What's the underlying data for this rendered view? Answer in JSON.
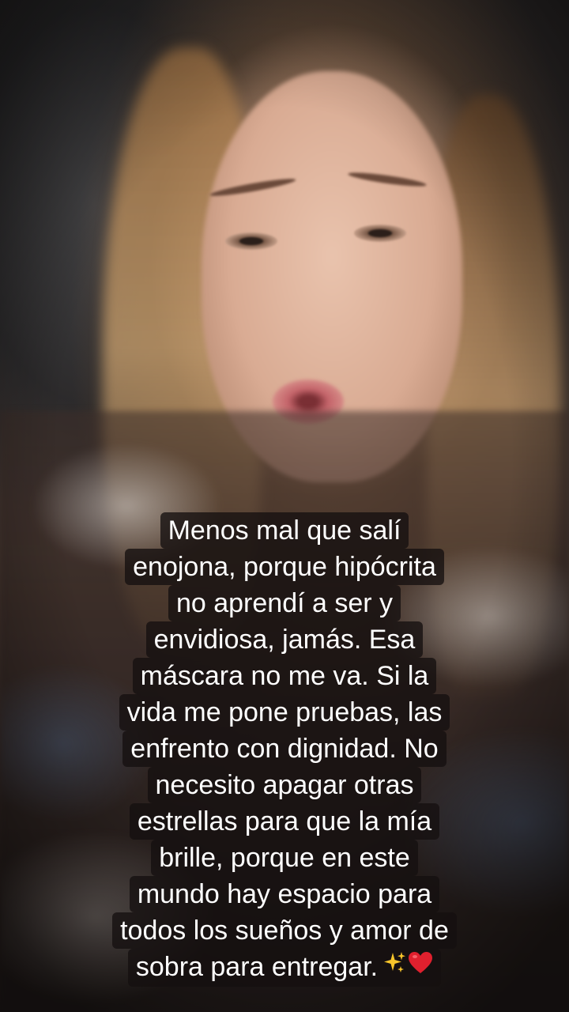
{
  "caption": {
    "lines": [
      "Menos mal que salí",
      "enojona, porque hipócrita",
      "no aprendí a ser y",
      "envidiosa, jamás. Esa",
      "máscara no me va. Si la",
      "vida me pone pruebas, las",
      "enfrento con dignidad. No",
      "necesito apagar otras",
      "estrellas para que la mía",
      "brille, porque en este",
      "mundo hay espacio para",
      "todos los sueños y amor de",
      "sobra para entregar."
    ],
    "trailing_icons": [
      "sparkles-icon",
      "red-heart-icon"
    ]
  },
  "colors": {
    "caption_background": "#141010",
    "caption_text": "#ffffff",
    "heart": "#e0202e",
    "sparkles": "#f7c52b"
  }
}
